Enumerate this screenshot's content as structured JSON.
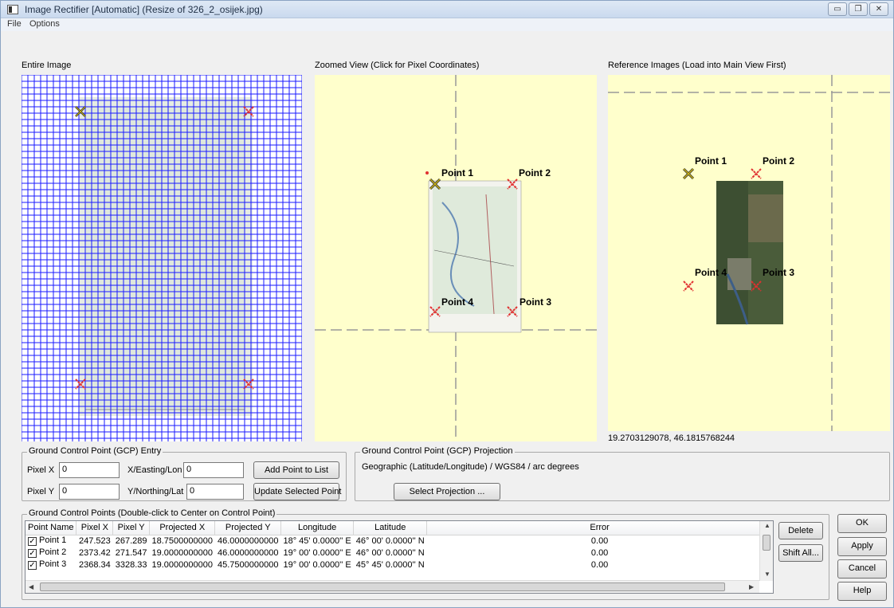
{
  "window": {
    "title": "Image Rectifier [Automatic] (Resize of 326_2_osijek.jpg)",
    "controls": [
      "minimize",
      "restore",
      "close"
    ]
  },
  "menu": {
    "file": "File",
    "options": "Options"
  },
  "panels": {
    "entire_image": "Entire Image",
    "zoomed_view": "Zoomed View (Click for Pixel Coordinates)",
    "reference_images": "Reference Images (Load into Main View First)",
    "reference_coords": "19.2703129078, 46.1815768244"
  },
  "zoom_points": [
    "Point 1",
    "Point 2",
    "Point 3",
    "Point 4"
  ],
  "reference_points": [
    "Point 1",
    "Point 2",
    "Point 3",
    "Point 4"
  ],
  "gcp_entry": {
    "legend": "Ground Control Point (GCP) Entry",
    "pixel_x_label": "Pixel X",
    "pixel_x_value": "0",
    "pixel_y_label": "Pixel Y",
    "pixel_y_value": "0",
    "easting_label": "X/Easting/Lon",
    "easting_value": "0",
    "northing_label": "Y/Northing/Lat",
    "northing_value": "0",
    "add_button": "Add Point to List",
    "update_button": "Update Selected Point"
  },
  "gcp_projection": {
    "legend": "Ground Control Point (GCP) Projection",
    "text": "Geographic (Latitude/Longitude) / WGS84 / arc degrees",
    "select_button": "Select Projection ..."
  },
  "gcp_list": {
    "legend": "Ground Control Points (Double-click to Center on Control Point)",
    "columns": [
      "Point Name",
      "Pixel X",
      "Pixel Y",
      "Projected X",
      "Projected Y",
      "Longitude",
      "Latitude",
      "Error"
    ],
    "rows": [
      {
        "name": "Point 1",
        "checked": true,
        "px": "247.523",
        "py": "267.289",
        "projx": "18.7500000000",
        "projy": "46.0000000000",
        "lon": "18° 45' 0.0000'' E",
        "lat": "46° 00' 0.0000'' N",
        "error": "0.00"
      },
      {
        "name": "Point 2",
        "checked": true,
        "px": "2373.42",
        "py": "271.547",
        "projx": "19.0000000000",
        "projy": "46.0000000000",
        "lon": "19° 00' 0.0000'' E",
        "lat": "46° 00' 0.0000'' N",
        "error": "0.00"
      },
      {
        "name": "Point 3",
        "checked": true,
        "px": "2368.34",
        "py": "3328.33",
        "projx": "19.0000000000",
        "projy": "45.7500000000",
        "lon": "19° 00' 0.0000'' E",
        "lat": "45° 45' 0.0000'' N",
        "error": "0.00"
      }
    ],
    "delete_button": "Delete",
    "shift_button": "Shift All..."
  },
  "dialog_buttons": {
    "ok": "OK",
    "apply": "Apply",
    "cancel": "Cancel",
    "help": "Help"
  },
  "colors": {
    "grid_line": "#1a1aff",
    "zoom_background": "#ffffcc",
    "marker_red": "#e03030",
    "marker_selected": "#c9b21a"
  }
}
